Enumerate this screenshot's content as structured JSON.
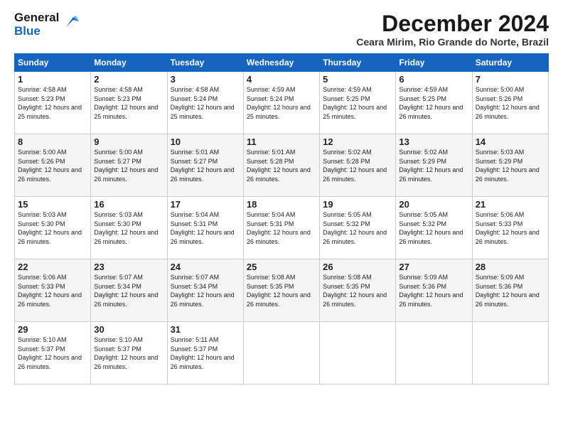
{
  "logo": {
    "line1": "General",
    "line2": "Blue"
  },
  "title": "December 2024",
  "location": "Ceara Mirim, Rio Grande do Norte, Brazil",
  "weekdays": [
    "Sunday",
    "Monday",
    "Tuesday",
    "Wednesday",
    "Thursday",
    "Friday",
    "Saturday"
  ],
  "weeks": [
    [
      {
        "day": "1",
        "sunrise": "Sunrise: 4:58 AM",
        "sunset": "Sunset: 5:23 PM",
        "daylight": "Daylight: 12 hours and 25 minutes."
      },
      {
        "day": "2",
        "sunrise": "Sunrise: 4:58 AM",
        "sunset": "Sunset: 5:23 PM",
        "daylight": "Daylight: 12 hours and 25 minutes."
      },
      {
        "day": "3",
        "sunrise": "Sunrise: 4:58 AM",
        "sunset": "Sunset: 5:24 PM",
        "daylight": "Daylight: 12 hours and 25 minutes."
      },
      {
        "day": "4",
        "sunrise": "Sunrise: 4:59 AM",
        "sunset": "Sunset: 5:24 PM",
        "daylight": "Daylight: 12 hours and 25 minutes."
      },
      {
        "day": "5",
        "sunrise": "Sunrise: 4:59 AM",
        "sunset": "Sunset: 5:25 PM",
        "daylight": "Daylight: 12 hours and 25 minutes."
      },
      {
        "day": "6",
        "sunrise": "Sunrise: 4:59 AM",
        "sunset": "Sunset: 5:25 PM",
        "daylight": "Daylight: 12 hours and 26 minutes."
      },
      {
        "day": "7",
        "sunrise": "Sunrise: 5:00 AM",
        "sunset": "Sunset: 5:26 PM",
        "daylight": "Daylight: 12 hours and 26 minutes."
      }
    ],
    [
      {
        "day": "8",
        "sunrise": "Sunrise: 5:00 AM",
        "sunset": "Sunset: 5:26 PM",
        "daylight": "Daylight: 12 hours and 26 minutes."
      },
      {
        "day": "9",
        "sunrise": "Sunrise: 5:00 AM",
        "sunset": "Sunset: 5:27 PM",
        "daylight": "Daylight: 12 hours and 26 minutes."
      },
      {
        "day": "10",
        "sunrise": "Sunrise: 5:01 AM",
        "sunset": "Sunset: 5:27 PM",
        "daylight": "Daylight: 12 hours and 26 minutes."
      },
      {
        "day": "11",
        "sunrise": "Sunrise: 5:01 AM",
        "sunset": "Sunset: 5:28 PM",
        "daylight": "Daylight: 12 hours and 26 minutes."
      },
      {
        "day": "12",
        "sunrise": "Sunrise: 5:02 AM",
        "sunset": "Sunset: 5:28 PM",
        "daylight": "Daylight: 12 hours and 26 minutes."
      },
      {
        "day": "13",
        "sunrise": "Sunrise: 5:02 AM",
        "sunset": "Sunset: 5:29 PM",
        "daylight": "Daylight: 12 hours and 26 minutes."
      },
      {
        "day": "14",
        "sunrise": "Sunrise: 5:03 AM",
        "sunset": "Sunset: 5:29 PM",
        "daylight": "Daylight: 12 hours and 26 minutes."
      }
    ],
    [
      {
        "day": "15",
        "sunrise": "Sunrise: 5:03 AM",
        "sunset": "Sunset: 5:30 PM",
        "daylight": "Daylight: 12 hours and 26 minutes."
      },
      {
        "day": "16",
        "sunrise": "Sunrise: 5:03 AM",
        "sunset": "Sunset: 5:30 PM",
        "daylight": "Daylight: 12 hours and 26 minutes."
      },
      {
        "day": "17",
        "sunrise": "Sunrise: 5:04 AM",
        "sunset": "Sunset: 5:31 PM",
        "daylight": "Daylight: 12 hours and 26 minutes."
      },
      {
        "day": "18",
        "sunrise": "Sunrise: 5:04 AM",
        "sunset": "Sunset: 5:31 PM",
        "daylight": "Daylight: 12 hours and 26 minutes."
      },
      {
        "day": "19",
        "sunrise": "Sunrise: 5:05 AM",
        "sunset": "Sunset: 5:32 PM",
        "daylight": "Daylight: 12 hours and 26 minutes."
      },
      {
        "day": "20",
        "sunrise": "Sunrise: 5:05 AM",
        "sunset": "Sunset: 5:32 PM",
        "daylight": "Daylight: 12 hours and 26 minutes."
      },
      {
        "day": "21",
        "sunrise": "Sunrise: 5:06 AM",
        "sunset": "Sunset: 5:33 PM",
        "daylight": "Daylight: 12 hours and 26 minutes."
      }
    ],
    [
      {
        "day": "22",
        "sunrise": "Sunrise: 5:06 AM",
        "sunset": "Sunset: 5:33 PM",
        "daylight": "Daylight: 12 hours and 26 minutes."
      },
      {
        "day": "23",
        "sunrise": "Sunrise: 5:07 AM",
        "sunset": "Sunset: 5:34 PM",
        "daylight": "Daylight: 12 hours and 26 minutes."
      },
      {
        "day": "24",
        "sunrise": "Sunrise: 5:07 AM",
        "sunset": "Sunset: 5:34 PM",
        "daylight": "Daylight: 12 hours and 26 minutes."
      },
      {
        "day": "25",
        "sunrise": "Sunrise: 5:08 AM",
        "sunset": "Sunset: 5:35 PM",
        "daylight": "Daylight: 12 hours and 26 minutes."
      },
      {
        "day": "26",
        "sunrise": "Sunrise: 5:08 AM",
        "sunset": "Sunset: 5:35 PM",
        "daylight": "Daylight: 12 hours and 26 minutes."
      },
      {
        "day": "27",
        "sunrise": "Sunrise: 5:09 AM",
        "sunset": "Sunset: 5:36 PM",
        "daylight": "Daylight: 12 hours and 26 minutes."
      },
      {
        "day": "28",
        "sunrise": "Sunrise: 5:09 AM",
        "sunset": "Sunset: 5:36 PM",
        "daylight": "Daylight: 12 hours and 26 minutes."
      }
    ],
    [
      {
        "day": "29",
        "sunrise": "Sunrise: 5:10 AM",
        "sunset": "Sunset: 5:37 PM",
        "daylight": "Daylight: 12 hours and 26 minutes."
      },
      {
        "day": "30",
        "sunrise": "Sunrise: 5:10 AM",
        "sunset": "Sunset: 5:37 PM",
        "daylight": "Daylight: 12 hours and 26 minutes."
      },
      {
        "day": "31",
        "sunrise": "Sunrise: 5:11 AM",
        "sunset": "Sunset: 5:37 PM",
        "daylight": "Daylight: 12 hours and 26 minutes."
      },
      null,
      null,
      null,
      null
    ]
  ]
}
